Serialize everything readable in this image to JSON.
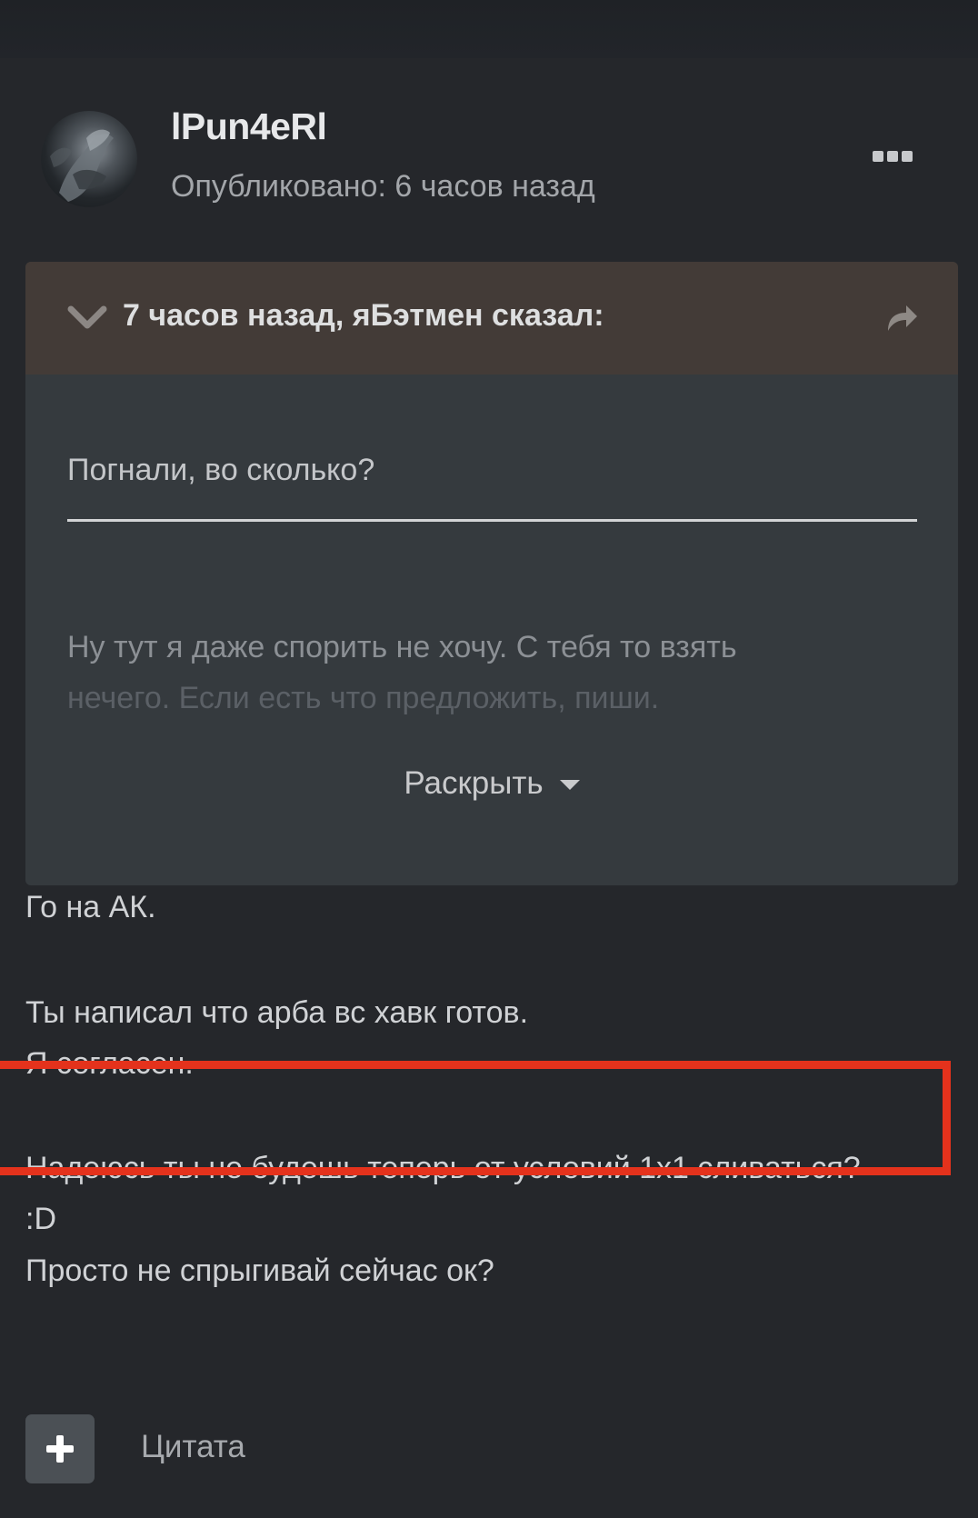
{
  "post": {
    "author": "lPun4eRl",
    "published": "Опубликовано: 6 часов назад",
    "menu_icon": "ellipsis-icon"
  },
  "quote": {
    "citation": "7 часов назад, яБэтмен сказал:",
    "collapse_icon": "chevron-down-icon",
    "share_icon": "share-arrow-icon",
    "line1": "Погнали, во сколько?",
    "line2": "Ну тут я даже спорить не хочу. С тебя то взять",
    "line3": "нечего. Если есть что предложить, пиши.",
    "expand_label": "Раскрыть"
  },
  "content": {
    "paragraph1": "Го на АК.",
    "paragraph2_line1": "Ты написал что арба вс хавк готов.",
    "paragraph2_line2": "Я согласен.",
    "highlighted_line1": "Надеюсь ты не будешь теперь от условий 1x1 сливаться?",
    "highlighted_line2": ":D",
    "paragraph4": "Просто не спрыгивай сейчас ок?"
  },
  "actions": {
    "add_icon": "plus-icon",
    "quote_label": "Цитата"
  },
  "colors": {
    "background": "#25272b",
    "quote_header": "#433b37",
    "quote_body": "#353a3e",
    "highlight_border": "#e4321c"
  }
}
